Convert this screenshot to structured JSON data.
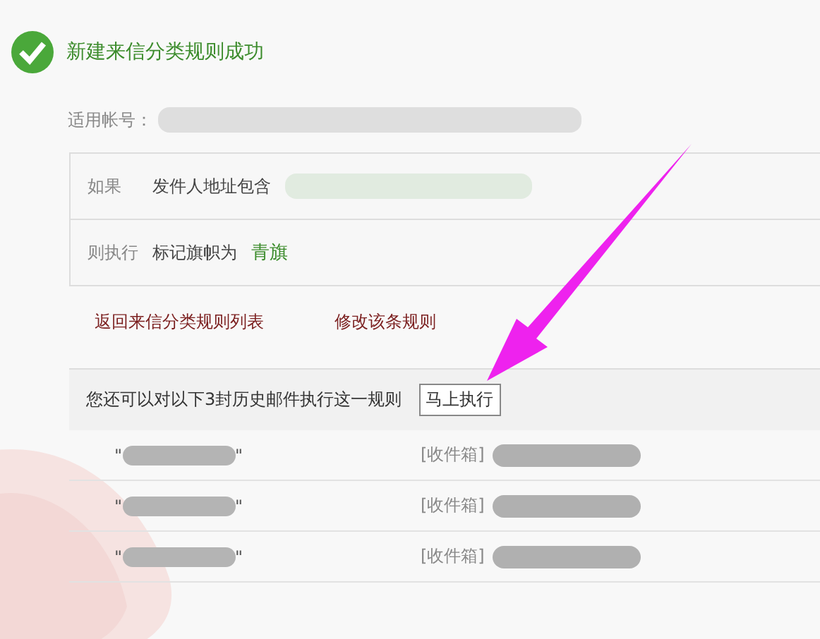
{
  "header": {
    "title": "新建来信分类规则成功"
  },
  "account": {
    "label": "适用帐号："
  },
  "rule": {
    "rows": [
      {
        "kind": "redacted",
        "label": "如果",
        "text": "发件人地址包含"
      },
      {
        "kind": "value",
        "label": "则执行",
        "text": "标记旗帜为",
        "value": "青旗"
      }
    ]
  },
  "links": [
    "返回来信分类规则列表",
    "修改该条规则"
  ],
  "history": {
    "prompt": "您还可以对以下3封历史邮件执行这一规则",
    "button": "马上执行",
    "mails": [
      {
        "open_quote": "\"",
        "close_quote": "\"",
        "folder": "[收件箱]"
      },
      {
        "open_quote": "\"",
        "close_quote": "\"",
        "folder": "[收件箱]"
      },
      {
        "open_quote": "\"",
        "close_quote": "\"",
        "folder": "[收件箱]"
      }
    ]
  }
}
